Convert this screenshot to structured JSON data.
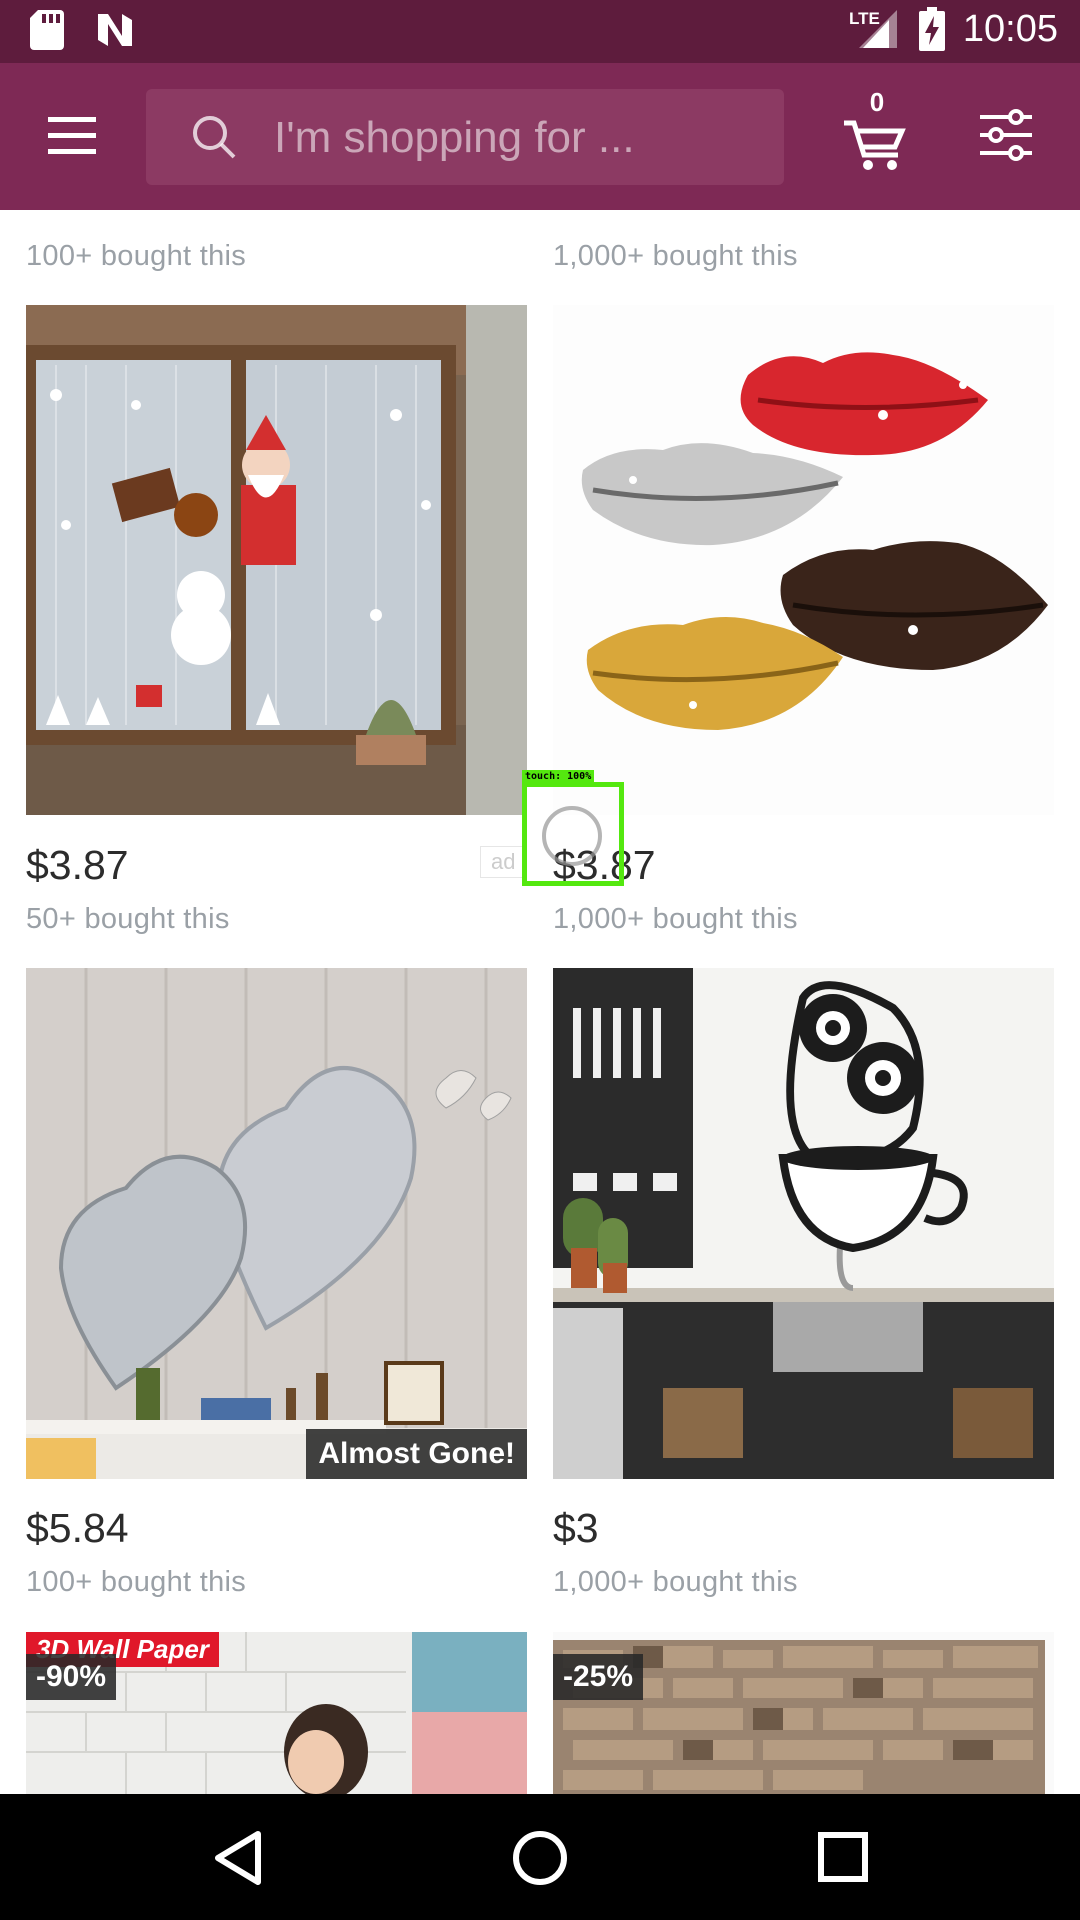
{
  "status_bar": {
    "time": "10:05",
    "network": "LTE",
    "left_icons": [
      "sd-card-icon",
      "n-notification-icon"
    ],
    "right_icons": [
      "lte-signal-icon",
      "battery-charging-icon"
    ]
  },
  "app_bar": {
    "search_placeholder": "I'm shopping for ...",
    "cart_count": "0",
    "icons": [
      "menu-icon",
      "search-icon",
      "cart-icon",
      "filter-icon"
    ],
    "color": "#7e2955",
    "status_color": "#5e1c3d"
  },
  "products_partial_top": [
    {
      "bought": "100+ bought this"
    },
    {
      "bought": "1,000+ bought this"
    }
  ],
  "products": [
    {
      "image": "christmas-window-stickers",
      "price": "$3.87",
      "bought": "50+ bought this",
      "ad_label": "ad"
    },
    {
      "image": "mirror-lips-wall-stickers",
      "price": "$3.87",
      "bought": "1,000+ bought this"
    },
    {
      "image": "mirror-heart-wall-decor",
      "price": "$5.84",
      "bought": "100+ bought this",
      "badge": "Almost Gone!"
    },
    {
      "image": "owl-coffee-cup-decal",
      "price": "$3",
      "bought": "1,000+ bought this"
    },
    {
      "image": "3d-brick-wallpaper",
      "discount": "-90%",
      "banner": "3D Wall Paper"
    },
    {
      "image": "stone-wall-panel",
      "discount": "-25%"
    }
  ],
  "touch_indicator": {
    "label": "touch: 100%"
  },
  "nav_bar": {
    "icons": [
      "back-icon",
      "home-icon",
      "recents-icon"
    ]
  }
}
